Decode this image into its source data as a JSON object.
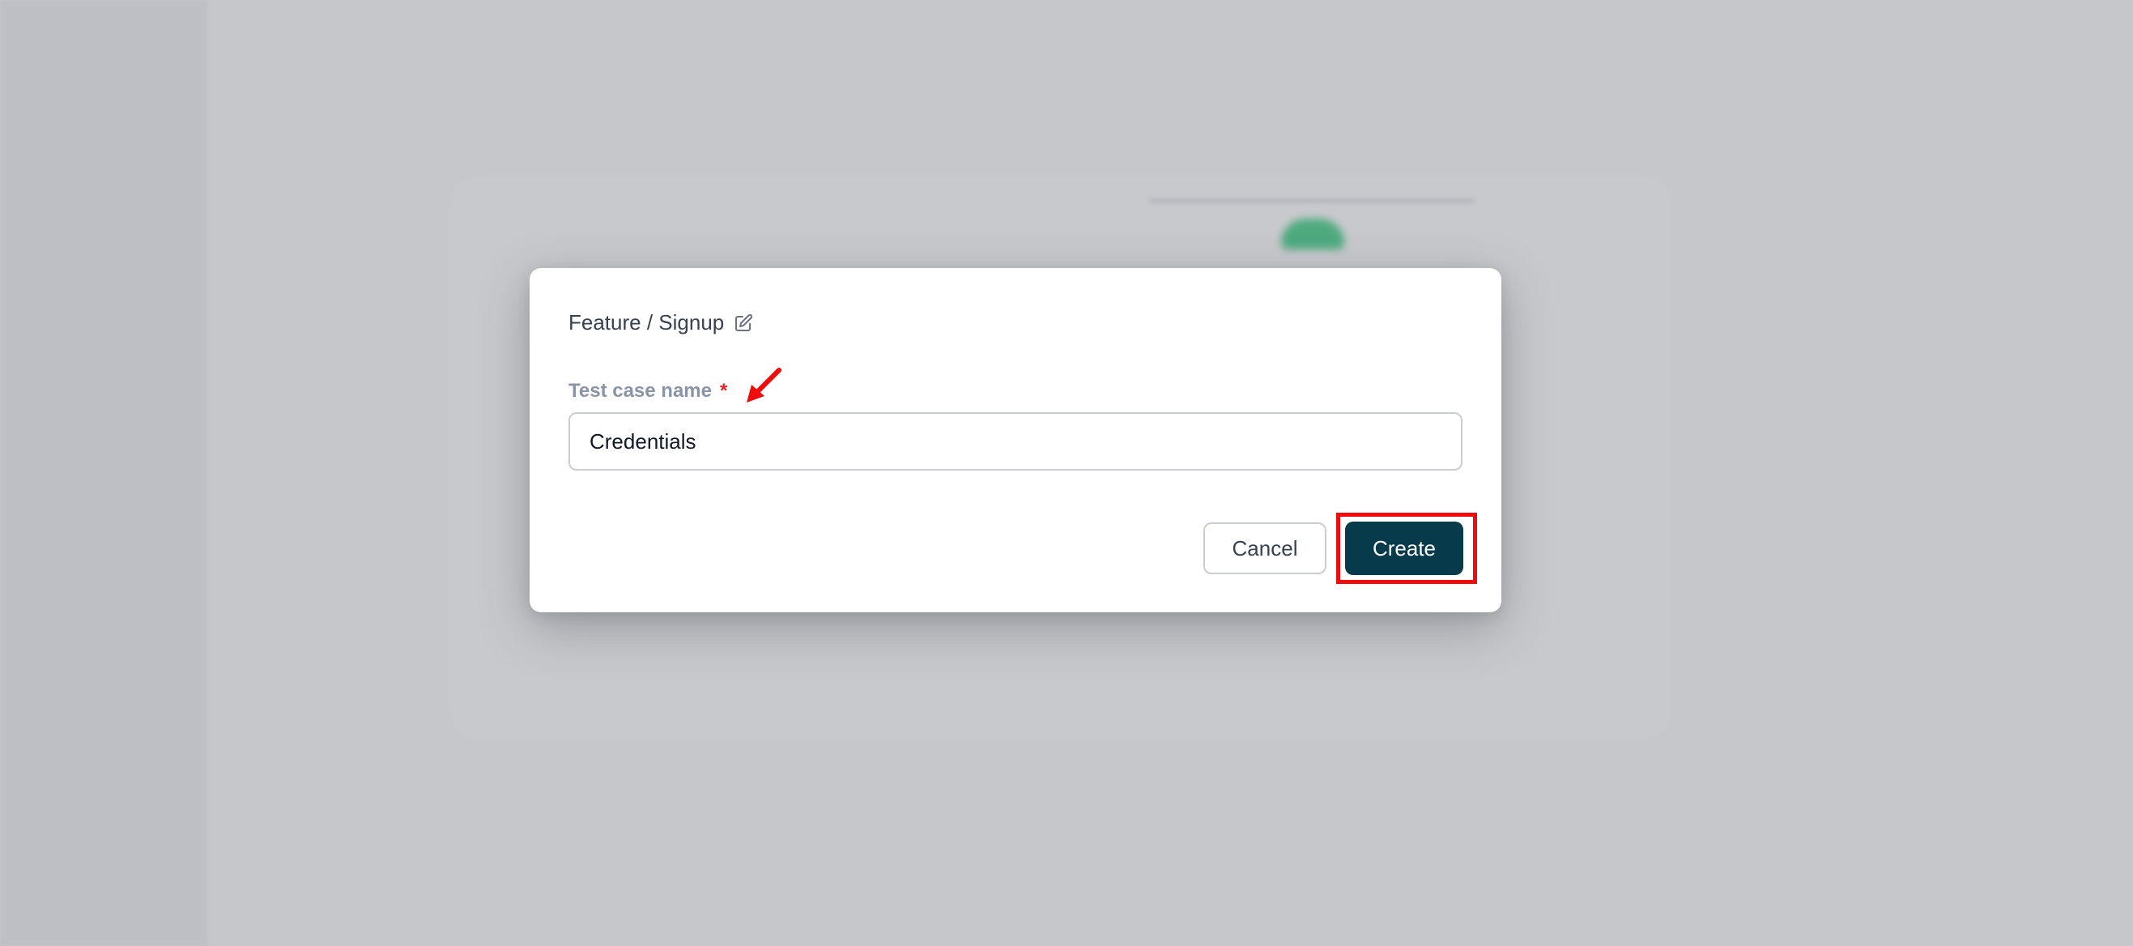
{
  "modal": {
    "breadcrumb": "Feature / Signup",
    "edit_icon": "edit-icon",
    "field": {
      "label": "Test case name",
      "required_mark": "*",
      "value": "Credentials"
    },
    "actions": {
      "cancel_label": "Cancel",
      "create_label": "Create"
    }
  },
  "colors": {
    "primary": "#073b4c",
    "required": "#e02424",
    "annotation": "#ee0c0c",
    "overlay": "#c6c7cb"
  }
}
